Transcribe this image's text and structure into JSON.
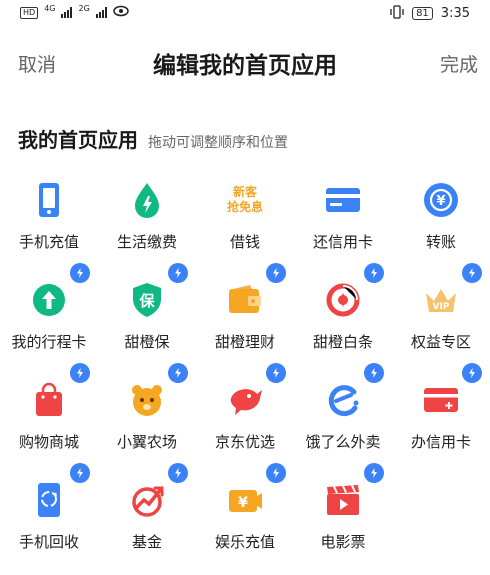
{
  "status_bar": {
    "hd_label": "HD",
    "net1": "4G",
    "net2": "2G",
    "battery": "81",
    "time": "3:35"
  },
  "header": {
    "cancel": "取消",
    "title": "编辑我的首页应用",
    "done": "完成"
  },
  "section": {
    "title": "我的首页应用",
    "subtitle": "拖动可调整顺序和位置"
  },
  "colors": {
    "accent_blue": "#3b82f6",
    "green": "#10b981",
    "orange": "#f5a623",
    "red": "#ef4444"
  },
  "apps": [
    {
      "label": "手机充值",
      "icon": "phone-icon",
      "badge": false
    },
    {
      "label": "生活缴费",
      "icon": "drop-bolt-icon",
      "badge": false
    },
    {
      "label": "借钱",
      "icon": "new-customer-text-icon",
      "badge": false,
      "icon_text_1": "新客",
      "icon_text_2": "抢免息"
    },
    {
      "label": "还信用卡",
      "icon": "credit-card-icon",
      "badge": false
    },
    {
      "label": "转账",
      "icon": "transfer-yuan-icon",
      "badge": false
    },
    {
      "label": "我的行程卡",
      "icon": "arrow-up-circle-icon",
      "badge": true
    },
    {
      "label": "甜橙保",
      "icon": "shield-bao-icon",
      "badge": true,
      "icon_text_1": "保"
    },
    {
      "label": "甜橙理财",
      "icon": "wallet-icon",
      "badge": true
    },
    {
      "label": "甜橙白条",
      "icon": "circle-swirl-icon",
      "badge": true
    },
    {
      "label": "权益专区",
      "icon": "vip-crown-icon",
      "badge": true,
      "icon_text_1": "VIP"
    },
    {
      "label": "购物商城",
      "icon": "shopping-bag-icon",
      "badge": true
    },
    {
      "label": "小翼农场",
      "icon": "bear-face-icon",
      "badge": true
    },
    {
      "label": "京东优选",
      "icon": "jd-dog-icon",
      "badge": true
    },
    {
      "label": "饿了么外卖",
      "icon": "eleme-icon",
      "badge": true
    },
    {
      "label": "办信用卡",
      "icon": "card-plus-icon",
      "badge": true
    },
    {
      "label": "手机回收",
      "icon": "recycle-phone-icon",
      "badge": true
    },
    {
      "label": "基金",
      "icon": "trend-circle-icon",
      "badge": true
    },
    {
      "label": "娱乐充值",
      "icon": "yuan-ticket-icon",
      "badge": true
    },
    {
      "label": "电影票",
      "icon": "film-clapper-icon",
      "badge": true
    }
  ]
}
